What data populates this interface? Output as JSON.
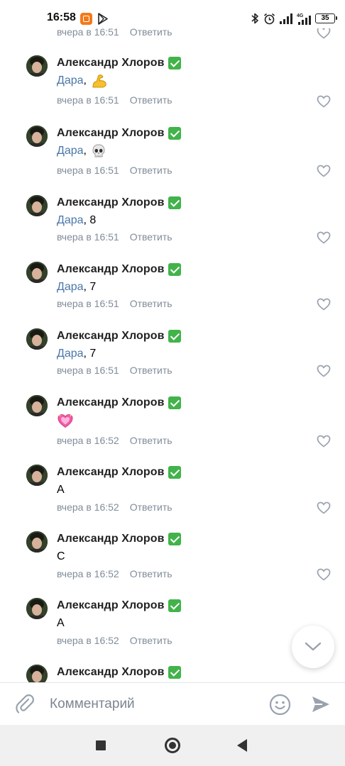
{
  "status_bar": {
    "time": "16:58",
    "battery": "35",
    "network": "4G"
  },
  "cut_comment": {
    "time": "вчера в 16:51",
    "reply_label": "Ответить"
  },
  "comments": [
    {
      "author": "Александр Хлоров",
      "mention": "Дара",
      "separator": ",",
      "text": "",
      "emoji": "flexed-biceps",
      "time": "вчера в 16:51",
      "reply_label": "Ответить"
    },
    {
      "author": "Александр Хлоров",
      "mention": "Дара",
      "separator": ",",
      "text": "",
      "emoji": "skull",
      "time": "вчера в 16:51",
      "reply_label": "Ответить"
    },
    {
      "author": "Александр Хлоров",
      "mention": "Дара",
      "separator": ",",
      "text": " 8",
      "emoji": "",
      "time": "вчера в 16:51",
      "reply_label": "Ответить"
    },
    {
      "author": "Александр Хлоров",
      "mention": "Дара",
      "separator": ",",
      "text": " 7",
      "emoji": "",
      "time": "вчера в 16:51",
      "reply_label": "Ответить"
    },
    {
      "author": "Александр Хлоров",
      "mention": "Дара",
      "separator": ",",
      "text": " 7",
      "emoji": "",
      "time": "вчера в 16:51",
      "reply_label": "Ответить"
    },
    {
      "author": "Александр Хлоров",
      "mention": "",
      "separator": "",
      "text": "",
      "emoji": "sparkling-heart",
      "time": "вчера в 16:52",
      "reply_label": "Ответить"
    },
    {
      "author": "Александр Хлоров",
      "mention": "",
      "separator": "",
      "text": "А",
      "emoji": "",
      "time": "вчера в 16:52",
      "reply_label": "Ответить"
    },
    {
      "author": "Александр Хлоров",
      "mention": "",
      "separator": "",
      "text": "С",
      "emoji": "",
      "time": "вчера в 16:52",
      "reply_label": "Ответить"
    },
    {
      "author": "Александр Хлоров",
      "mention": "",
      "separator": "",
      "text": "А",
      "emoji": "",
      "time": "вчера в 16:52",
      "reply_label": "Ответить"
    },
    {
      "author": "Александр Хлоров",
      "mention": "",
      "separator": "",
      "text": "",
      "emoji": "",
      "time": "",
      "reply_label": ""
    }
  ],
  "input": {
    "placeholder": "Комментарий",
    "value": ""
  },
  "icons": {
    "attach": "paperclip-icon",
    "emoji": "smiley-icon",
    "send": "send-icon",
    "scroll_down": "chevron-down-icon",
    "like": "heart-outline-icon",
    "verified": "verified-check-icon"
  },
  "colors": {
    "mention": "#4a76a8",
    "meta": "#818c99",
    "verified": "#41b34a",
    "icon_gray": "#99a2ad"
  }
}
